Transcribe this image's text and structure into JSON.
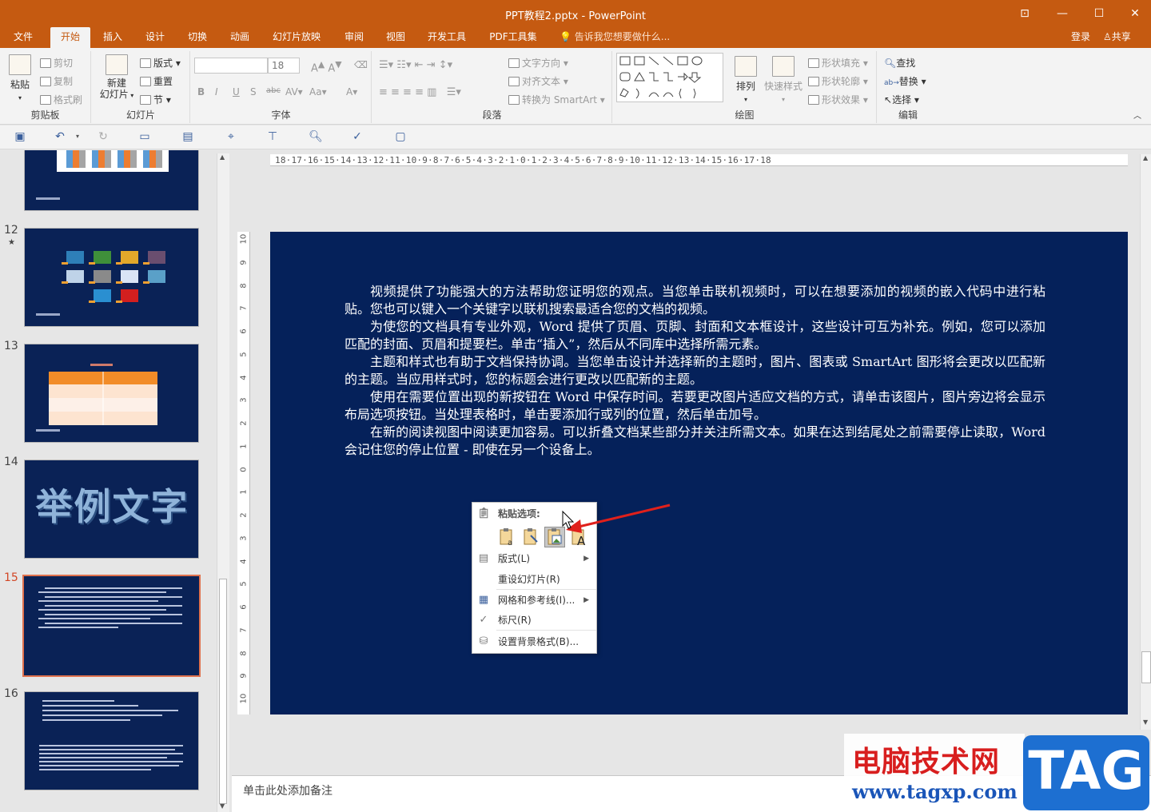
{
  "window": {
    "title": "PPT教程2.pptx - PowerPoint"
  },
  "tabs": [
    {
      "label": "文件"
    },
    {
      "label": "开始"
    },
    {
      "label": "插入"
    },
    {
      "label": "设计"
    },
    {
      "label": "切换"
    },
    {
      "label": "动画"
    },
    {
      "label": "幻灯片放映"
    },
    {
      "label": "审阅"
    },
    {
      "label": "视图"
    },
    {
      "label": "开发工具"
    },
    {
      "label": "PDF工具集"
    }
  ],
  "tell_me": "告诉我您想要做什么...",
  "account": {
    "login": "登录",
    "share": "共享"
  },
  "ribbon": {
    "clipboard": {
      "label": "剪贴板",
      "paste": "粘贴",
      "cut": "剪切",
      "copy": "复制",
      "format_painter": "格式刷"
    },
    "slides": {
      "label": "幻灯片",
      "new_slide": "新建",
      "new_slide2": "幻灯片",
      "layout": "版式",
      "reset": "重置",
      "section": "节"
    },
    "font": {
      "label": "字体",
      "font_size": "18"
    },
    "paragraph": {
      "label": "段落",
      "text_direction": "文字方向",
      "align_text": "对齐文本",
      "smartart": "转换为 SmartArt"
    },
    "drawing": {
      "label": "绘图",
      "arrange": "排列",
      "quick_styles": "快速样式",
      "shape_fill": "形状填充",
      "shape_outline": "形状轮廓",
      "shape_effects": "形状效果"
    },
    "editing": {
      "label": "编辑",
      "find": "查找",
      "replace": "替换",
      "select": "选择"
    }
  },
  "thumbnails": {
    "numbers": [
      "12",
      "13",
      "14",
      "15",
      "16"
    ],
    "star": "★",
    "slide14_text": "举例文字"
  },
  "ruler": {
    "horizontal": "18·17·16·15·14·13·12·11·10·9·8·7·6·5·4·3·2·1·0·1·2·3·4·5·6·7·8·9·10·11·12·13·14·15·16·17·18",
    "vertical": [
      "10",
      "9",
      "8",
      "7",
      "6",
      "5",
      "4",
      "3",
      "2",
      "1",
      "0",
      "1",
      "2",
      "3",
      "4",
      "5",
      "6",
      "7",
      "8",
      "9",
      "10"
    ]
  },
  "slide": {
    "paragraphs": [
      "视频提供了功能强大的方法帮助您证明您的观点。当您单击联机视频时，可以在想要添加的视频的嵌入代码中进行粘贴。您也可以键入一个关键字以联机搜索最适合您的文档的视频。",
      "为使您的文档具有专业外观，Word 提供了页眉、页脚、封面和文本框设计，这些设计可互为补充。例如，您可以添加匹配的封面、页眉和提要栏。单击“插入”，然后从不同库中选择所需元素。",
      "主题和样式也有助于文档保持协调。当您单击设计并选择新的主题时，图片、图表或 SmartArt 图形将会更改以匹配新的主题。当应用样式时，您的标题会进行更改以匹配新的主题。",
      "使用在需要位置出现的新按钮在 Word 中保存时间。若要更改图片适应文档的方式，请单击该图片，图片旁边将会显示布局选项按钮。当处理表格时，单击要添加行或列的位置，然后单击加号。",
      "在新的阅读视图中阅读更加容易。可以折叠文档某些部分并关注所需文本。如果在达到结尾处之前需要停止读取，Word 会记住您的停止位置 - 即使在另一个设备上。"
    ]
  },
  "context_menu": {
    "paste_options": "粘贴选项:",
    "layout": "版式(L)",
    "reset_slide": "重设幻灯片(R)",
    "grid_guides": "网格和参考线(I)...",
    "ruler": "标尺(R)",
    "format_background": "设置背景格式(B)..."
  },
  "notes": {
    "placeholder": "单击此处添加备注"
  },
  "watermark": {
    "title": "电脑技术网",
    "url": "www.tagxp.com",
    "tag": "TAG"
  },
  "colors": {
    "accent": "#c55a11",
    "slide_bg": "#05215a",
    "arrow": "#e0201b"
  }
}
